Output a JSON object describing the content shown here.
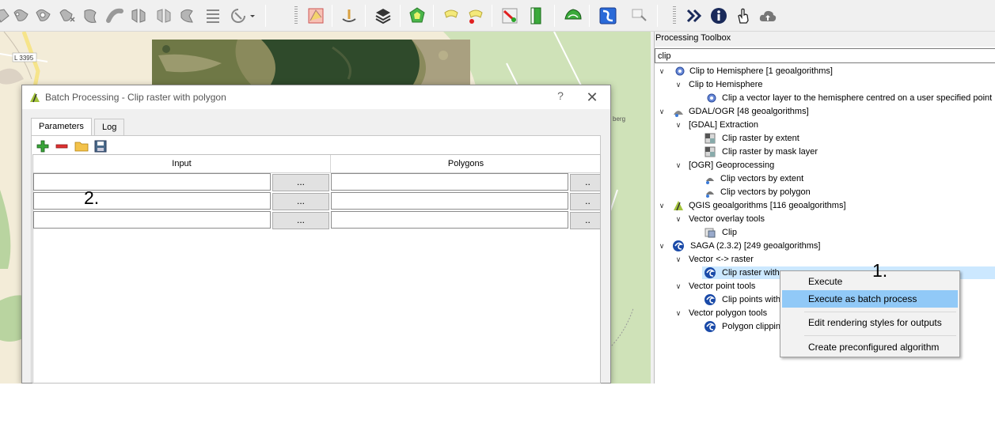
{
  "dialog": {
    "title": "Batch Processing - Clip raster with polygon",
    "help": "?",
    "close": "✕",
    "tabs": {
      "parameters": "Parameters",
      "log": "Log"
    },
    "columns": [
      "Input",
      "Polygons"
    ],
    "row_button": "...",
    "row_button_partial": "..",
    "annotation": "2."
  },
  "toolbox": {
    "title": "Processing Toolbox",
    "search_value": "clip",
    "tree": [
      {
        "id": "hemi-group",
        "text": "Clip to Hemisphere [1 geoalgorithms]",
        "icon": "gear-icon"
      },
      {
        "id": "hemi-sub",
        "text": "Clip to Hemisphere"
      },
      {
        "id": "hemi-alg",
        "text": "Clip a vector layer to the hemisphere centred on a user specified point",
        "icon": "gear-icon"
      },
      {
        "id": "gdal-group",
        "text": "GDAL/OGR [48 geoalgorithms]",
        "icon": "gdal-icon"
      },
      {
        "id": "gdal-extract",
        "text": "[GDAL] Extraction"
      },
      {
        "id": "gdal-extent",
        "text": "Clip raster by extent",
        "icon": "raster-icon"
      },
      {
        "id": "gdal-mask",
        "text": "Clip raster by mask layer",
        "icon": "raster-icon"
      },
      {
        "id": "ogr-geo",
        "text": "[OGR] Geoprocessing"
      },
      {
        "id": "ogr-extent",
        "text": "Clip vectors by extent",
        "icon": "ogr-icon"
      },
      {
        "id": "ogr-poly",
        "text": "Clip vectors by polygon",
        "icon": "ogr-icon"
      },
      {
        "id": "qgis-group",
        "text": "QGIS geoalgorithms [116 geoalgorithms]",
        "icon": "qgis-icon"
      },
      {
        "id": "qgis-overlay",
        "text": "Vector overlay tools"
      },
      {
        "id": "qgis-clip",
        "text": "Clip",
        "icon": "clip-icon"
      },
      {
        "id": "saga-group",
        "text": "SAGA (2.3.2) [249 geoalgorithms]",
        "icon": "saga-icon"
      },
      {
        "id": "saga-vr",
        "text": "Vector <-> raster"
      },
      {
        "id": "saga-cr",
        "text": "Clip raster with",
        "icon": "saga-icon"
      },
      {
        "id": "saga-vp",
        "text": "Vector point tools"
      },
      {
        "id": "saga-cp",
        "text": "Clip points with",
        "icon": "saga-icon"
      },
      {
        "id": "saga-vpoly",
        "text": "Vector polygon tools"
      },
      {
        "id": "saga-pc",
        "text": "Polygon clipping",
        "icon": "saga-icon"
      }
    ]
  },
  "context_menu": {
    "items": [
      "Execute",
      "Execute as batch process",
      "Edit rendering styles for outputs",
      "Create preconfigured algorithm"
    ],
    "highlighted": "Execute as batch process",
    "annotation": "1."
  },
  "map": {
    "labels": [
      "L 3395",
      "berg"
    ]
  },
  "colors": {
    "selection": "#cce8ff",
    "menu_highlight": "#91c9f7",
    "map_background": "#f3ecd8",
    "forest": "#cfe2b8"
  }
}
